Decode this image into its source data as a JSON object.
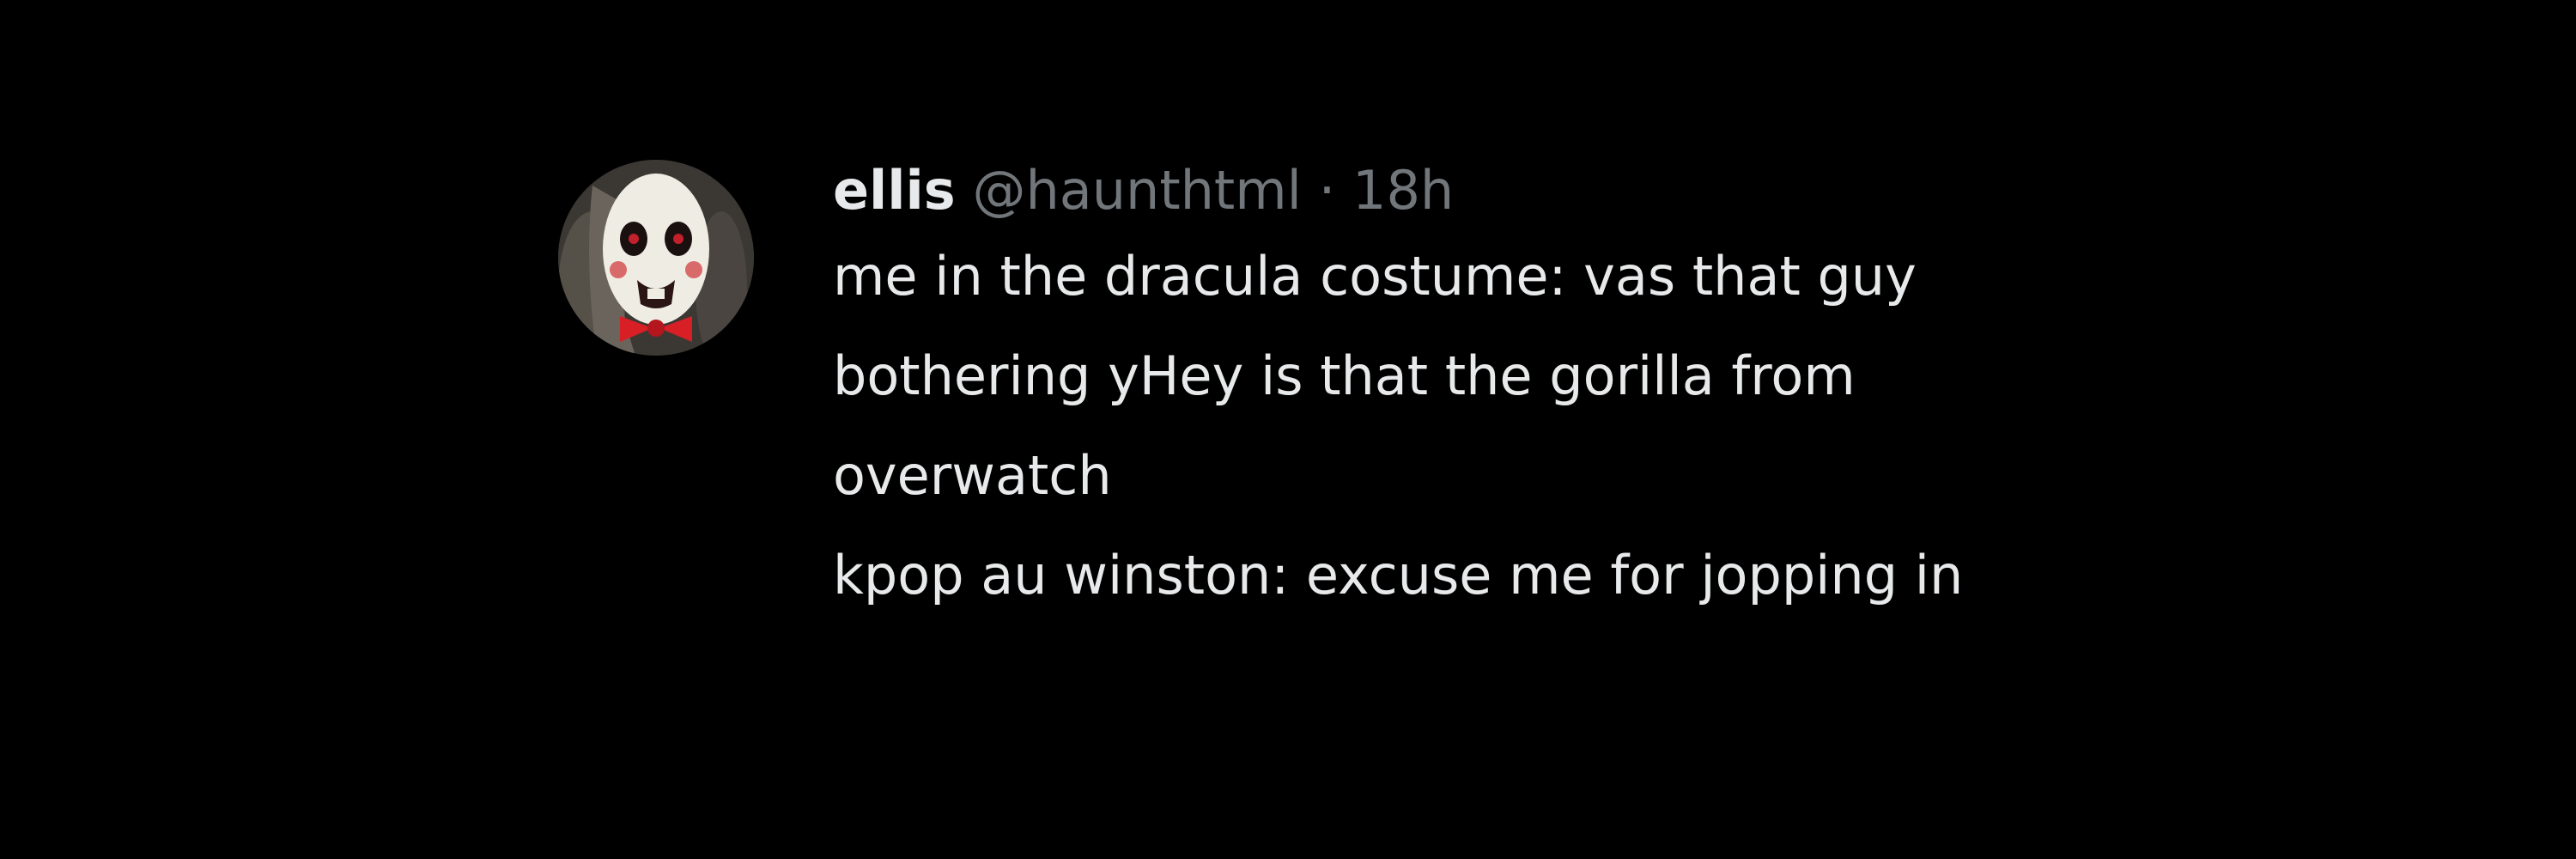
{
  "tweet": {
    "author_name": "ellis",
    "handle": "@haunthtml",
    "separator": "·",
    "time": "18h",
    "lines": [
      "me in the dracula costume: vas that guy",
      "bothering yHey is that the gorilla from",
      "overwatch",
      "kpop au winston: excuse me for jopping in"
    ]
  },
  "colors": {
    "background": "#000000",
    "primary_text": "#e7e9ea",
    "secondary_text": "#71767b",
    "bow_tie": "#d81f26"
  },
  "icons": {
    "avatar": "puppet-clown-avatar"
  }
}
